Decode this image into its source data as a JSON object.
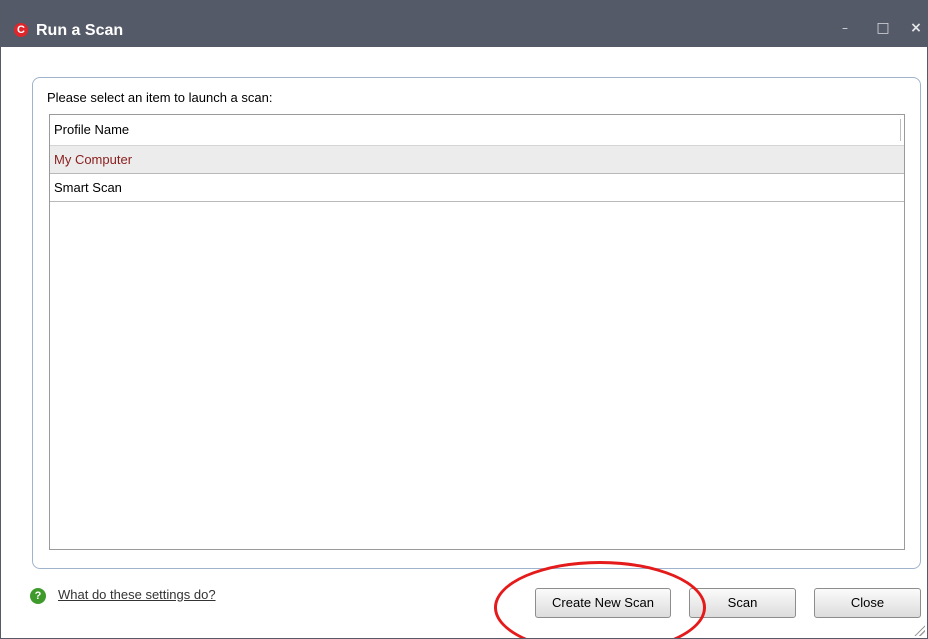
{
  "window": {
    "title": "Run a Scan",
    "app_icon_letter": "C",
    "controls": {
      "minimize": "–",
      "maximize": "□",
      "close": "×"
    }
  },
  "panel": {
    "instruction": "Please select an item to launch a scan:",
    "list": {
      "column_header": "Profile Name",
      "rows": [
        {
          "label": "My Computer",
          "selected": true
        },
        {
          "label": "Smart Scan",
          "selected": false
        }
      ]
    }
  },
  "footer": {
    "help_icon_glyph": "?",
    "help_link": "What do these settings do?",
    "buttons": {
      "create_new_scan": "Create New Scan",
      "scan": "Scan",
      "close": "Close"
    }
  },
  "icons": {
    "app_icon": "comodo-c-logo-icon",
    "help_icon": "question-circle-icon"
  },
  "colors": {
    "titlebar": "#555a68",
    "selected_row_text": "#8b1d1d",
    "highlight_annotation": "#e51a1a",
    "help_icon": "#3f9a2c"
  }
}
